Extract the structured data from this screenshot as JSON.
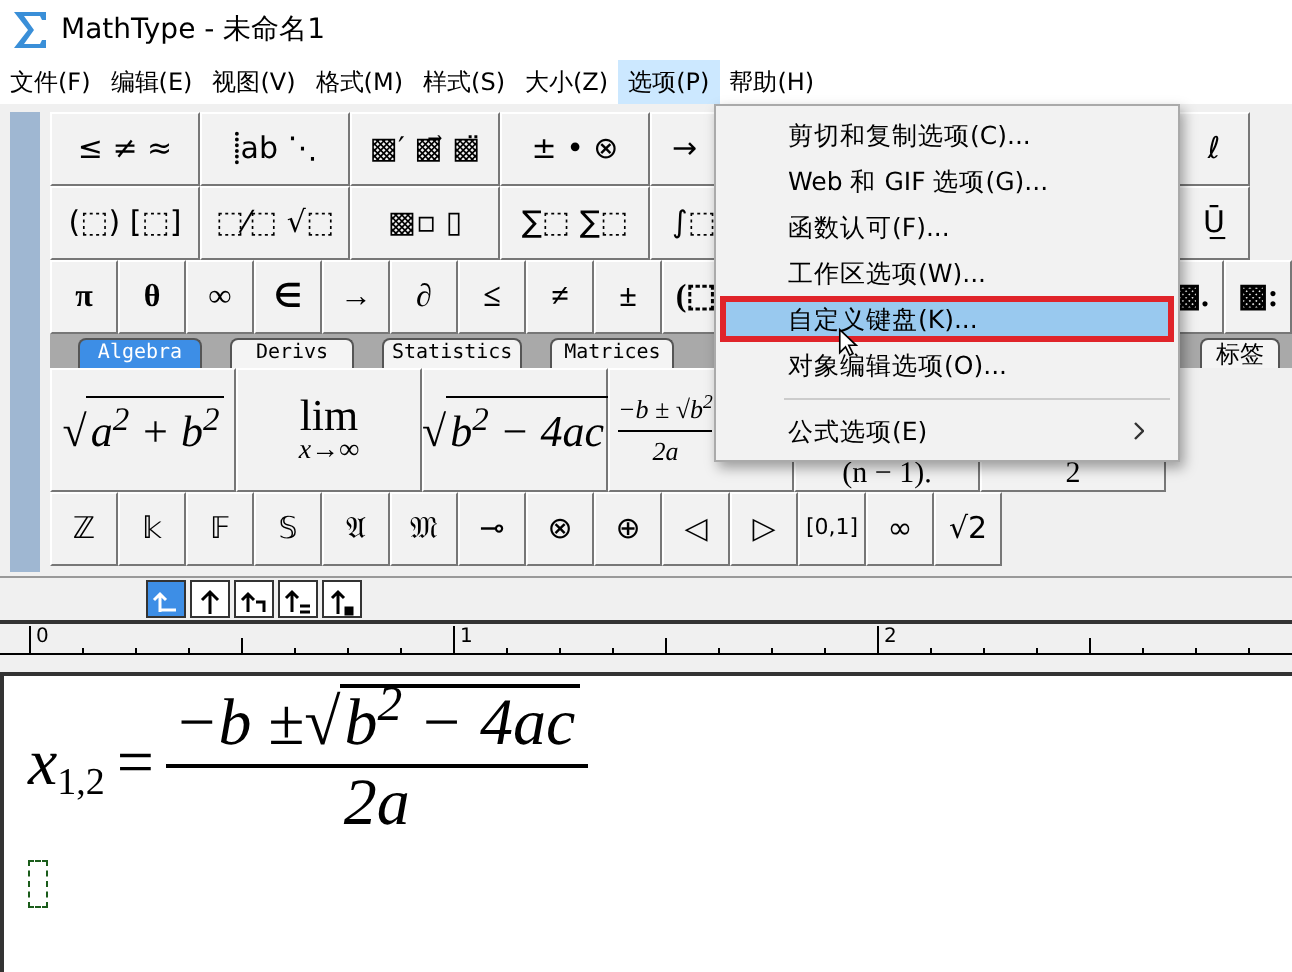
{
  "window": {
    "title": "MathType - 未命名1"
  },
  "menu_bar": [
    {
      "label": "文件(F)",
      "selected": false
    },
    {
      "label": "编辑(E)",
      "selected": false
    },
    {
      "label": "视图(V)",
      "selected": false
    },
    {
      "label": "格式(M)",
      "selected": false
    },
    {
      "label": "样式(S)",
      "selected": false
    },
    {
      "label": "大小(Z)",
      "selected": false
    },
    {
      "label": "选项(P)",
      "selected": true
    },
    {
      "label": "帮助(H)",
      "selected": false
    }
  ],
  "palette": {
    "template_rows": [
      {
        "left": [
          "≤ ≠ ≈",
          "⸽ab ⋱",
          "▩′ ▩⃗ ▩̈",
          "± • ⊗",
          "→"
        ],
        "right": [
          "ℓ"
        ]
      },
      {
        "left": [
          "(⬚) [⬚]",
          "⬚⁄⬚ √⬚",
          "▩▫ ▯",
          "∑⬚ ∑⬚",
          "∫⬚"
        ],
        "right": [
          "Ū̲"
        ]
      }
    ],
    "symbol_row": {
      "left": [
        "π",
        "θ",
        "∞",
        "∈",
        "→",
        "∂",
        "≤",
        "≠",
        "±",
        "(⬚"
      ],
      "right": [
        "▩.",
        "▩:"
      ]
    },
    "tabs": {
      "left": [
        {
          "label": "Algebra",
          "selected": true
        },
        {
          "label": "Derivs",
          "selected": false
        },
        {
          "label": "Statistics",
          "selected": false
        },
        {
          "label": "Matrices",
          "selected": false
        }
      ],
      "right": [
        {
          "label": "标签",
          "selected": false
        }
      ]
    },
    "templates": [
      {
        "kind": "sqrt",
        "radical": "√",
        "radicand": "a$^{2}$ + b$^{2}$"
      },
      {
        "kind": "limit",
        "top": "lim",
        "bottom": "x→∞"
      },
      {
        "kind": "sqrt",
        "radical": "√",
        "radicand": "b$^{2}$ − 4ac"
      },
      {
        "kind": "fraction",
        "numerator": "−b ± √b$^{2}$",
        "denominator": "2a"
      },
      {
        "kind": "text",
        "text": "(n − 1)."
      },
      {
        "kind": "text",
        "text": "2"
      }
    ],
    "bottom_row": [
      "ℤ",
      "𝕜",
      "𝔽",
      "𝕊",
      "𝔄",
      "𝔐",
      "⊸",
      "⊗",
      "⊕",
      "◁",
      "▷",
      "[0,1]",
      "∞",
      "√2"
    ]
  },
  "nudge_buttons": [
    {
      "kind": "corner",
      "selected": true
    },
    {
      "kind": "up",
      "selected": false
    },
    {
      "kind": "step",
      "selected": false
    },
    {
      "kind": "lines",
      "selected": false
    },
    {
      "kind": "dot",
      "selected": false
    }
  ],
  "ruler": {
    "labels": [
      "0",
      "1",
      "2"
    ]
  },
  "equation": {
    "variable": "x",
    "subscript": "1,2",
    "relation": "=",
    "numerator_prefix": "−b ±",
    "radical": "√",
    "radicand": "b$^{2}$ − 4ac",
    "denominator": "2a"
  },
  "options_menu": [
    {
      "kind": "item",
      "label": "剪切和复制选项(C)...",
      "selected": false,
      "outlined": false,
      "submenu": false
    },
    {
      "kind": "item",
      "label": "Web 和 GIF 选项(G)...",
      "selected": false,
      "outlined": false,
      "submenu": false
    },
    {
      "kind": "item",
      "label": "函数认可(F)...",
      "selected": false,
      "outlined": false,
      "submenu": false
    },
    {
      "kind": "item",
      "label": "工作区选项(W)...",
      "selected": false,
      "outlined": false,
      "submenu": false
    },
    {
      "kind": "item",
      "label": "自定义键盘(K)...",
      "selected": true,
      "outlined": true,
      "submenu": false
    },
    {
      "kind": "item",
      "label": "对象编辑选项(O)...",
      "selected": false,
      "outlined": false,
      "submenu": false
    },
    {
      "kind": "separator"
    },
    {
      "kind": "item",
      "label": "公式选项(E)",
      "selected": false,
      "outlined": false,
      "submenu": true
    }
  ]
}
